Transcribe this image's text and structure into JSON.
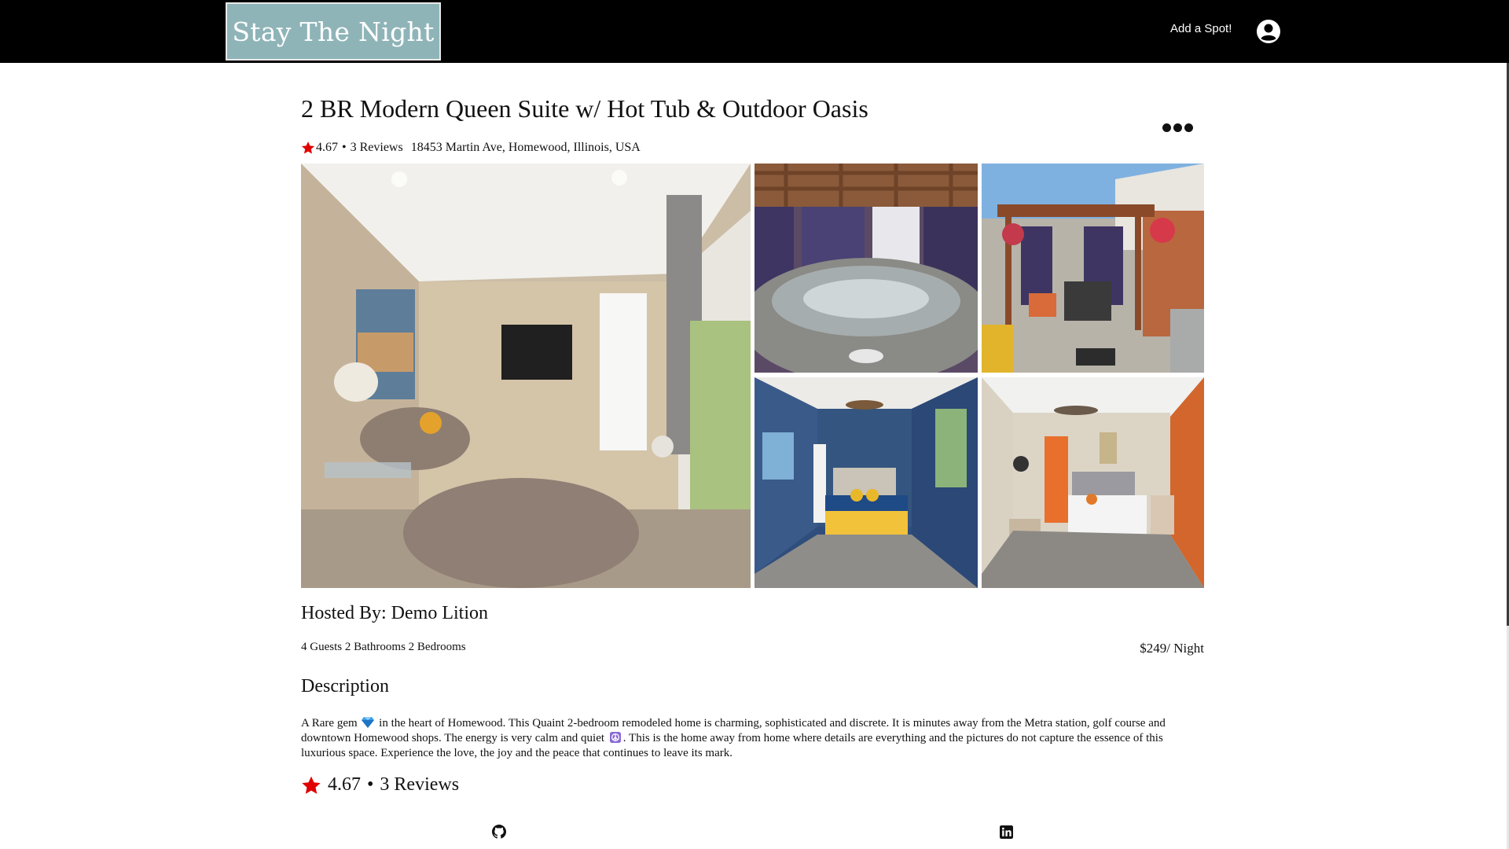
{
  "header": {
    "logo_text": "Stay The Night",
    "add_spot_label": "Add a Spot!",
    "user_icon": "user-circle-icon"
  },
  "listing": {
    "title": "2 BR Modern Queen Suite w/ Hot Tub & Outdoor Oasis",
    "rating": "4.67",
    "bullet": "•",
    "reviews_label": "3 Reviews",
    "address": "18453 Martin Ave, Homewood, Illinois, USA",
    "more_icon": "more-options-icon"
  },
  "host": {
    "hosted_by": "Hosted By: Demo Lition",
    "specs": "4 Guests 2 Bathrooms 2 Bedrooms",
    "price": "$249/ Night"
  },
  "description": {
    "heading": "Description",
    "part1": "A Rare gem",
    "part2": "in the heart of Homewood. This Quaint 2-bedroom remodeled home is charming, sophisticated and discrete. It is minutes away from the Metra station, golf course and downtown Homewood shops. The energy is very calm and quiet",
    "part3": ". This is the home away from home where details are everything and the pictures do not capture the essence of this luxurious space. Experience the love, the joy and the peace that continues to leave its mark."
  },
  "review_summary": {
    "rating": "4.67",
    "bullet": "•",
    "reviews_label": "3 Reviews"
  },
  "footer": {
    "github_icon": "github-icon",
    "linkedin_icon": "linkedin-icon"
  },
  "colors": {
    "header_bg": "#000000",
    "logo_bg": "#8fb4b8",
    "star": "#e00000"
  }
}
